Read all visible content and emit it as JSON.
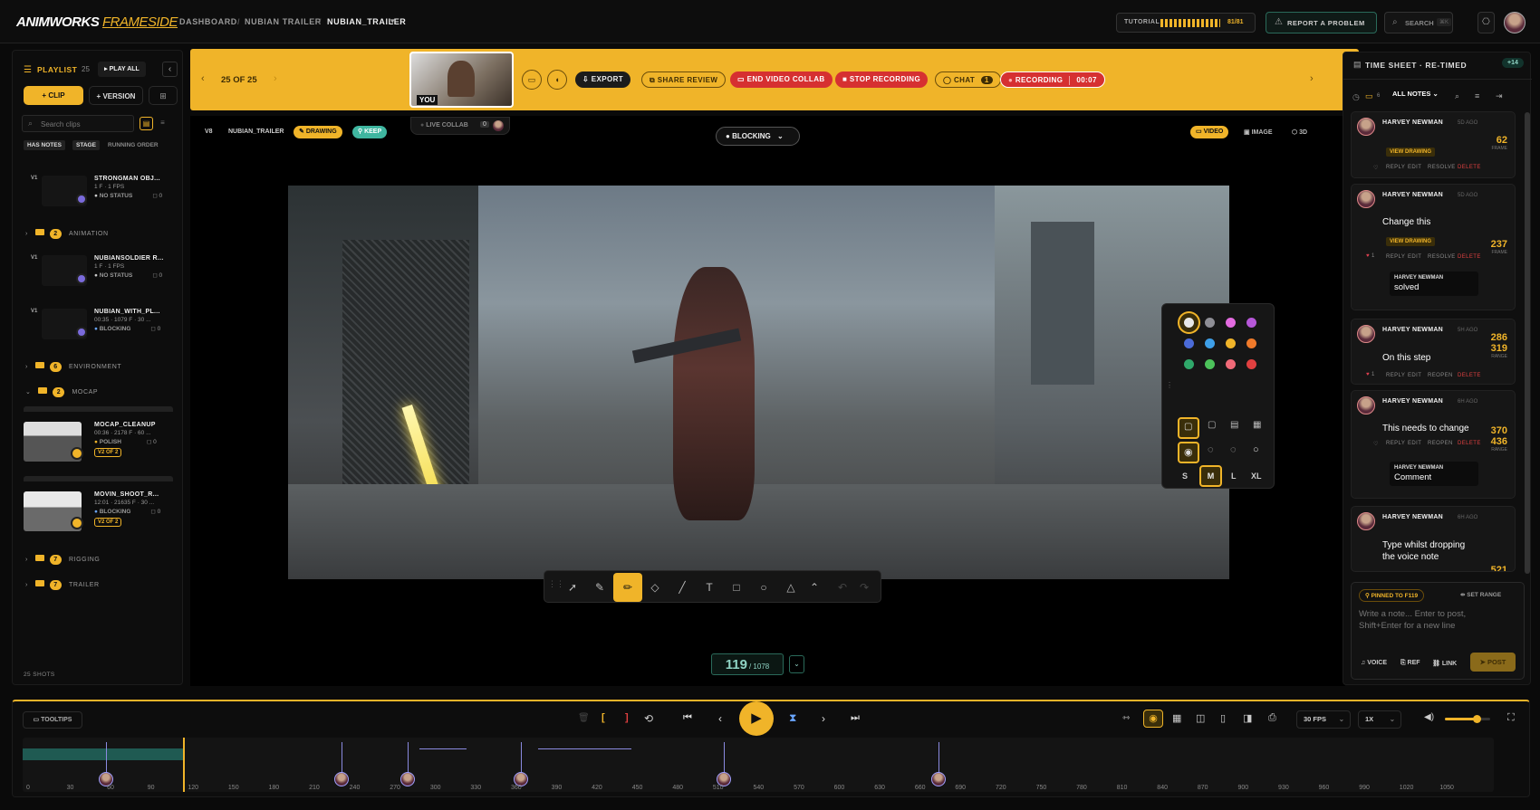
{
  "app": {
    "logo_main": "ANIMWORKS",
    "logo_sub": "FRAMESIDE"
  },
  "breadcrumb": [
    "DASHBOARD",
    "NUBIAN TRAILER",
    "NUBIAN_TRAILER"
  ],
  "header": {
    "tutorial_label": "TUTORIAL",
    "tutorial_progress": "81/81",
    "tutorial_fraction": 1.0,
    "report_label": "REPORT A PROBLEM",
    "search_label": "SEARCH",
    "search_shortcut": "⌘K"
  },
  "playlist": {
    "title": "PLAYLIST",
    "count": "25",
    "play_all": "PLAY ALL",
    "clip_btn": "CLIP",
    "version_btn": "VERSION",
    "search_placeholder": "Search clips",
    "filters": [
      "HAS NOTES",
      "STAGE",
      "RUNNING ORDER"
    ],
    "footer": "25 SHOTS",
    "clips": [
      {
        "ver": "V1",
        "title": "STRONGMAN OBJ...",
        "meta": "1 F · 1 FPS",
        "status": "NO STATUS",
        "notes": "0"
      },
      {
        "ver": "V1",
        "title": "NUBIANSOLDIER R...",
        "meta": "1 F · 1 FPS",
        "status": "NO STATUS",
        "notes": "0"
      },
      {
        "ver": "V1",
        "title": "NUBIAN_WITH_PL...",
        "meta": "00:35 · 1079 F · 30 ...",
        "status": "BLOCKING",
        "notes": "0"
      },
      {
        "ver": "",
        "title": "MOCAP_CLEANUP",
        "meta": "00:36 · 2178 F · 60 ...",
        "status": "POLISH",
        "notes": "0",
        "badge": "V2 OF 2"
      },
      {
        "ver": "",
        "title": "MOVIN_SHOOT_R...",
        "meta": "12:01 · 21635 F · 30 ...",
        "status": "BLOCKING",
        "notes": "0",
        "badge": "V2 OF 2"
      }
    ],
    "groups": [
      {
        "count": "2",
        "name": "ANIMATION"
      },
      {
        "count": "6",
        "name": "ENVIRONMENT"
      },
      {
        "count": "2",
        "name": "MOCAP"
      },
      {
        "count": "7",
        "name": "RIGGING"
      },
      {
        "count": "7",
        "name": "TRAILER"
      }
    ]
  },
  "review_bar": {
    "position": "25 OF 25",
    "you_label": "YOU",
    "export": "EXPORT",
    "share": "SHARE REVIEW",
    "end_collab": "END VIDEO COLLAB",
    "stop_rec": "STOP RECORDING",
    "chat": "CHAT",
    "chat_count": "1",
    "recording": "RECORDING",
    "rec_time": "00:07"
  },
  "viewer": {
    "version": "V8",
    "clip_name": "NUBIAN_TRAILER",
    "drawing_label": "DRAWING",
    "keep_label": "KEEP",
    "live_collab": "LIVE COLLAB",
    "live_count": "0",
    "stage": "BLOCKING",
    "modes": [
      "VIDEO",
      "IMAGE",
      "3D"
    ],
    "frame_current": "119",
    "frame_total": "/ 1078"
  },
  "palette": {
    "colors": [
      "#e8e8e8",
      "#8e8e95",
      "#e36be0",
      "#b657d8",
      "#4b6bd8",
      "#3e9fe8",
      "#f0b429",
      "#f07a2a",
      "#2fa86a",
      "#4cc25a",
      "#f06a78",
      "#e04040"
    ],
    "sizes": [
      "S",
      "M",
      "L",
      "XL"
    ]
  },
  "notes_panel": {
    "title": "TIME SHEET · RE-TIMED",
    "count_badge": "+14",
    "notes_count": "6",
    "filter": "ALL NOTES",
    "comments": [
      {
        "author": "HARVEY NEWMAN",
        "ago": "5D AGO",
        "text": "",
        "view": "VIEW DRAWING",
        "frame": "62",
        "frame_label": "FRAME",
        "actions": [
          "REPLY",
          "EDIT",
          "RESOLVE",
          "DELETE"
        ],
        "likes": ""
      },
      {
        "author": "HARVEY NEWMAN",
        "ago": "5D AGO",
        "text": "Change this",
        "view": "VIEW DRAWING",
        "frame": "237",
        "frame_label": "FRAME",
        "actions": [
          "REPLY",
          "EDIT",
          "RESOLVE",
          "DELETE"
        ],
        "likes": "1",
        "reply_author": "HARVEY NEWMAN",
        "reply_text": "solved"
      },
      {
        "author": "HARVEY NEWMAN",
        "ago": "5H AGO",
        "text": "On this step",
        "frame": "286",
        "frame2": "319",
        "frame_label": "RANGE",
        "actions": [
          "REPLY",
          "EDIT",
          "REOPEN",
          "DELETE"
        ],
        "likes": "1"
      },
      {
        "author": "HARVEY NEWMAN",
        "ago": "6H AGO",
        "text": "This needs to change",
        "frame": "370",
        "frame2": "436",
        "frame_label": "RANGE",
        "actions": [
          "REPLY",
          "EDIT",
          "REOPEN",
          "DELETE"
        ],
        "likes": "",
        "reply_author": "HARVEY NEWMAN",
        "reply_text": "Comment"
      },
      {
        "author": "HARVEY NEWMAN",
        "ago": "6H AGO",
        "text": "Type whilst dropping the voice note",
        "frame": "521"
      }
    ],
    "composer": {
      "pinned": "PINNED TO F119",
      "set_range": "SET RANGE",
      "placeholder": "Write a note... Enter to post, Shift+Enter for a new line",
      "voice": "VOICE",
      "ref": "REF",
      "link": "LINK",
      "post": "POST"
    }
  },
  "timeline": {
    "tooltips": "TOOLTIPS",
    "fps": "30 FPS",
    "speed": "1X",
    "volume": 0.7,
    "ticks": [
      "0",
      "30",
      "60",
      "90",
      "120",
      "150",
      "180",
      "210",
      "240",
      "270",
      "300",
      "330",
      "360",
      "390",
      "420",
      "450",
      "480",
      "510",
      "540",
      "570",
      "600",
      "630",
      "660",
      "690",
      "720",
      "750",
      "780",
      "810",
      "840",
      "870",
      "900",
      "930",
      "960",
      "990",
      "1020",
      "1050"
    ],
    "playhead_frame": 119,
    "markers": [
      62,
      237,
      286,
      370,
      521,
      680
    ]
  }
}
